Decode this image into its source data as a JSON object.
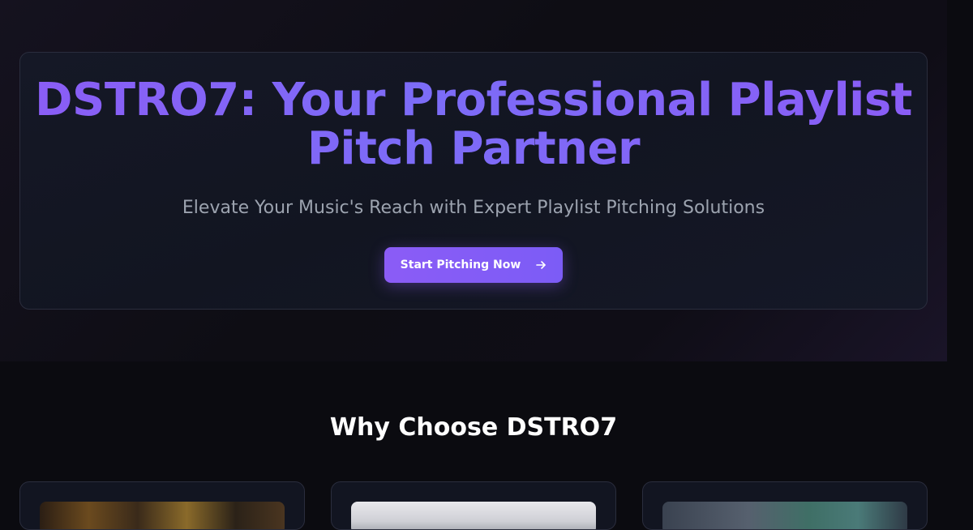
{
  "hero": {
    "title_line1": "DSTRO7: Your Professional Playlist",
    "title_line2": "Pitch Partner",
    "subtitle": "Elevate Your Music's Reach with Expert Playlist Pitching Solutions",
    "cta_label": "Start Pitching Now",
    "cta_icon": "arrow-right-icon"
  },
  "features": {
    "title": "Why Choose DSTRO7"
  },
  "colors": {
    "accent": "#8b5cf6",
    "background": "#0b0b10",
    "card": "#121521",
    "muted_text": "#9ca3af"
  }
}
